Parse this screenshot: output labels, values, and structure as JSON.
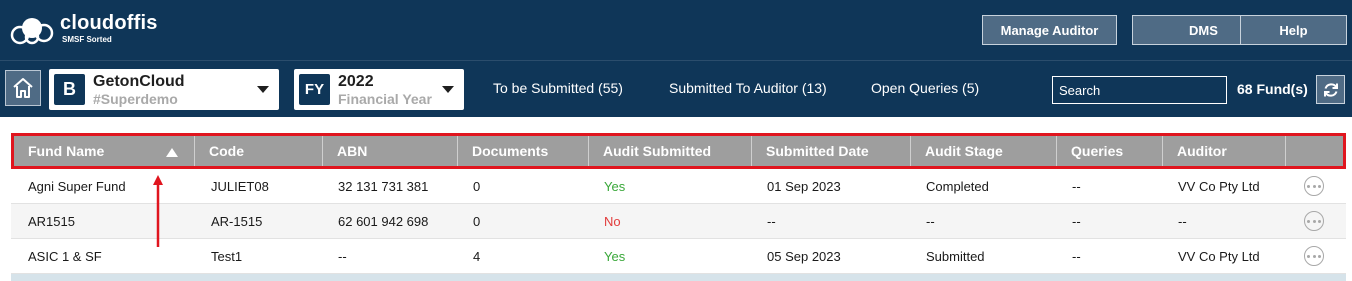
{
  "app": {
    "logo_name": "cloudoffis",
    "logo_tagline": "SMSF Sorted",
    "brand_color": "#0f3658",
    "header_buttons": {
      "manage_auditor": "Manage Auditor",
      "dms": "DMS",
      "help": "Help"
    }
  },
  "toolbar": {
    "client": {
      "badge": "B",
      "name": "GetonCloud",
      "subtitle": "#Superdemo"
    },
    "financial_year": {
      "badge": "FY",
      "year": "2022",
      "subtitle": "Financial Year"
    },
    "links": {
      "to_be_submitted": "To be Submitted (55)",
      "submitted_to_auditor": "Submitted To Auditor (13)",
      "open_queries": "Open Queries (5)"
    },
    "search_placeholder": "Search",
    "fund_count": "68 Fund(s)"
  },
  "table": {
    "columns": [
      "Fund Name",
      "Code",
      "ABN",
      "Documents",
      "Audit Submitted",
      "Submitted Date",
      "Audit Stage",
      "Queries",
      "Auditor",
      ""
    ],
    "sort": {
      "column": "Fund Name",
      "direction": "ascending"
    },
    "rows": [
      {
        "fund_name": "Agni Super Fund",
        "code": "JULIET08",
        "abn": "32 131 731 381",
        "documents": "0",
        "audit_submitted": "Yes",
        "submitted_date": "01 Sep 2023",
        "audit_stage": "Completed",
        "queries": "--",
        "auditor": "VV Co Pty Ltd"
      },
      {
        "fund_name": "AR1515",
        "code": "AR-1515",
        "abn": "62 601 942 698",
        "documents": "0",
        "audit_submitted": "No",
        "submitted_date": "--",
        "audit_stage": "--",
        "queries": "--",
        "auditor": "--"
      },
      {
        "fund_name": "ASIC 1 & SF",
        "code": "Test1",
        "abn": "--",
        "documents": "4",
        "audit_submitted": "Yes",
        "submitted_date": "05 Sep 2023",
        "audit_stage": "Submitted",
        "queries": "--",
        "auditor": "VV Co Pty Ltd"
      }
    ]
  },
  "annotation": {
    "highlight_color": "#e0151e"
  }
}
